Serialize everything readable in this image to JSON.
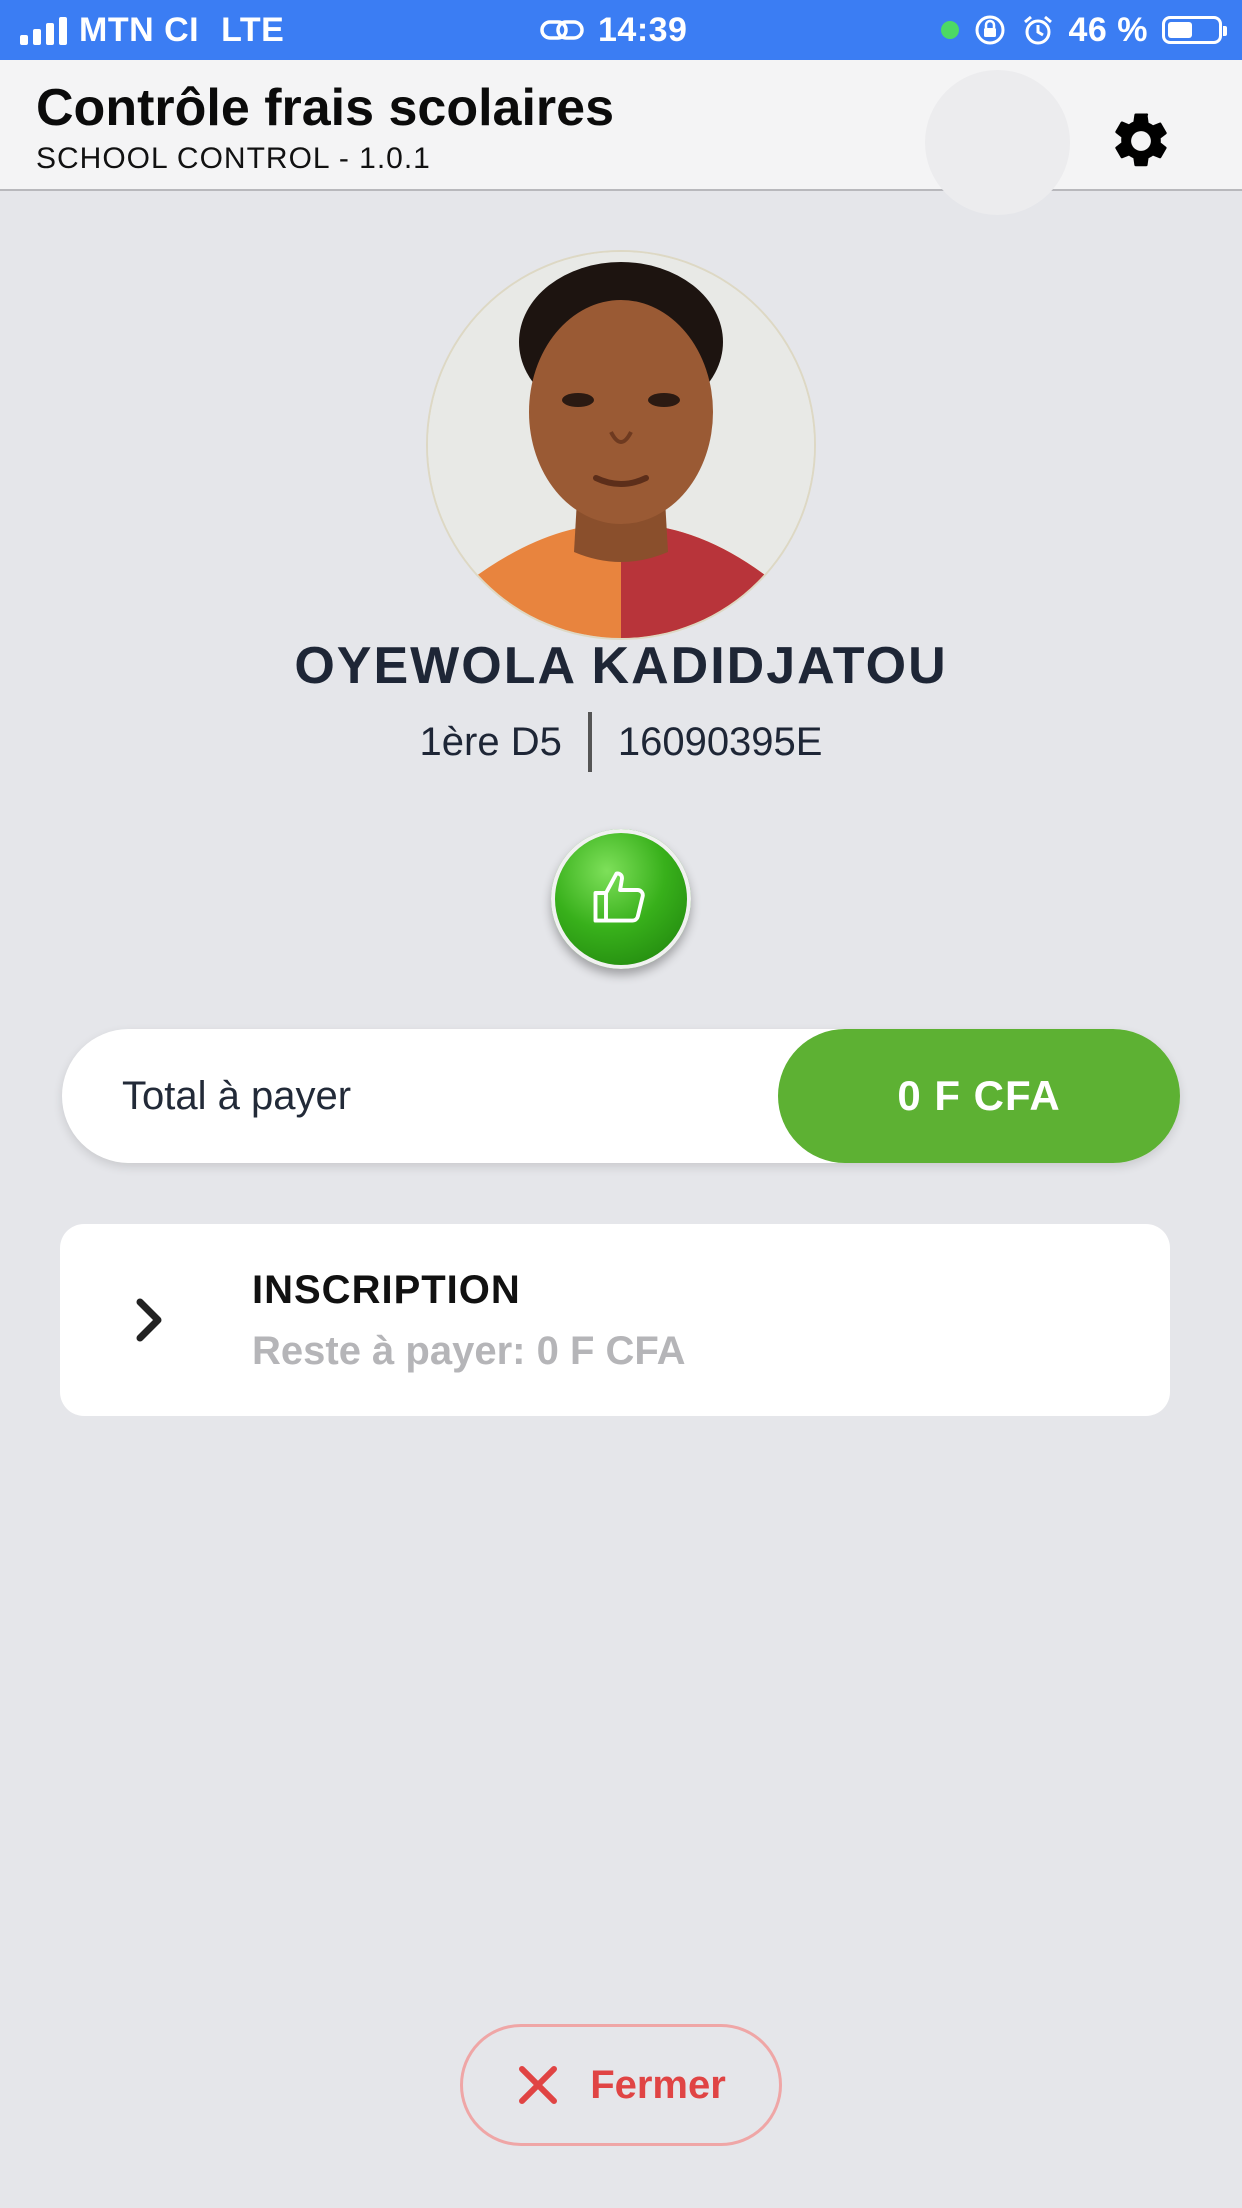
{
  "status_bar": {
    "carrier": "MTN CI",
    "network": "LTE",
    "time": "14:39",
    "battery": "46 %",
    "icons": [
      "signal-icon",
      "link-icon",
      "green-dot-icon",
      "orientation-lock-icon",
      "alarm-icon",
      "battery-icon"
    ]
  },
  "header": {
    "title": "Contrôle frais scolaires",
    "subtitle": "SCHOOL CONTROL - 1.0.1",
    "settings_icon": "gear-icon"
  },
  "student": {
    "name": "OYEWOLA KADIDJATOU",
    "class": "1ère D5",
    "id": "16090395E",
    "status_icon": "thumbs-up-icon"
  },
  "total": {
    "label": "Total à payer",
    "value": "0 F CFA"
  },
  "fees": [
    {
      "title": "INSCRIPTION",
      "remaining": "Reste à payer: 0 F CFA"
    }
  ],
  "actions": {
    "close_label": "Fermer"
  },
  "colors": {
    "status_bar": "#3b7df3",
    "success_green": "#5db133",
    "close_red": "#e04444",
    "background": "#e5e6ea"
  }
}
